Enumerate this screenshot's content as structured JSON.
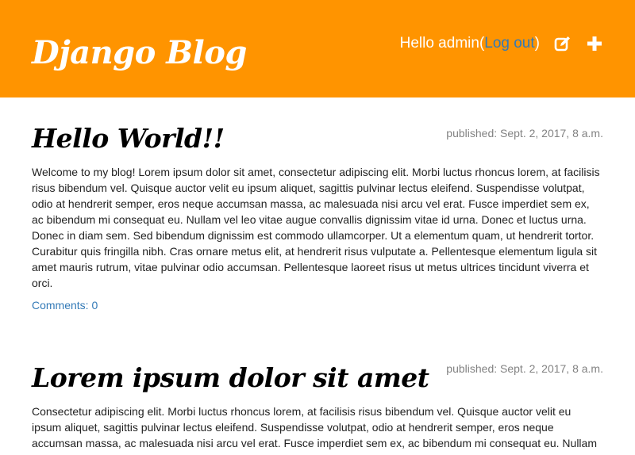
{
  "header": {
    "brand": "Django Blog",
    "greeting": "Hello admin",
    "logout_open": "(",
    "logout_label": "Log out",
    "logout_close": ")",
    "icons": [
      "edit-icon",
      "plus-icon"
    ]
  },
  "posts": [
    {
      "title": "Hello World!!",
      "published": "published: Sept. 2, 2017, 8 a.m.",
      "body": "Welcome to my blog! Lorem ipsum dolor sit amet, consectetur adipiscing elit. Morbi luctus rhoncus lorem, at facilisis risus bibendum vel. Quisque auctor velit eu ipsum aliquet, sagittis pulvinar lectus eleifend. Suspendisse volutpat, odio at hendrerit semper, eros neque accumsan massa, ac malesuada nisi arcu vel erat. Fusce imperdiet sem ex, ac bibendum mi consequat eu. Nullam vel leo vitae augue convallis dignissim vitae id urna. Donec et luctus urna. Donec in diam sem. Sed bibendum dignissim est commodo ullamcorper. Ut a elementum quam, ut hendrerit tortor. Curabitur quis fringilla nibh. Cras ornare metus elit, at hendrerit risus vulputate a. Pellentesque elementum ligula sit amet mauris rutrum, vitae pulvinar odio accumsan. Pellentesque laoreet risus ut metus ultrices tincidunt viverra et orci.",
      "comments": "Comments: 0"
    },
    {
      "title": "Lorem ipsum dolor sit amet",
      "published": "published: Sept. 2, 2017, 8 a.m.",
      "body": "Consectetur adipiscing elit. Morbi luctus rhoncus lorem, at facilisis risus bibendum vel. Quisque auctor velit eu ipsum aliquet, sagittis pulvinar lectus eleifend. Suspendisse volutpat, odio at hendrerit semper, eros neque accumsan massa, ac malesuada nisi arcu vel erat. Fusce imperdiet sem ex, ac bibendum mi consequat eu. Nullam"
    }
  ],
  "colors": {
    "header_bg": "#ff9400",
    "link": "#337ab7",
    "date": "#828282"
  }
}
